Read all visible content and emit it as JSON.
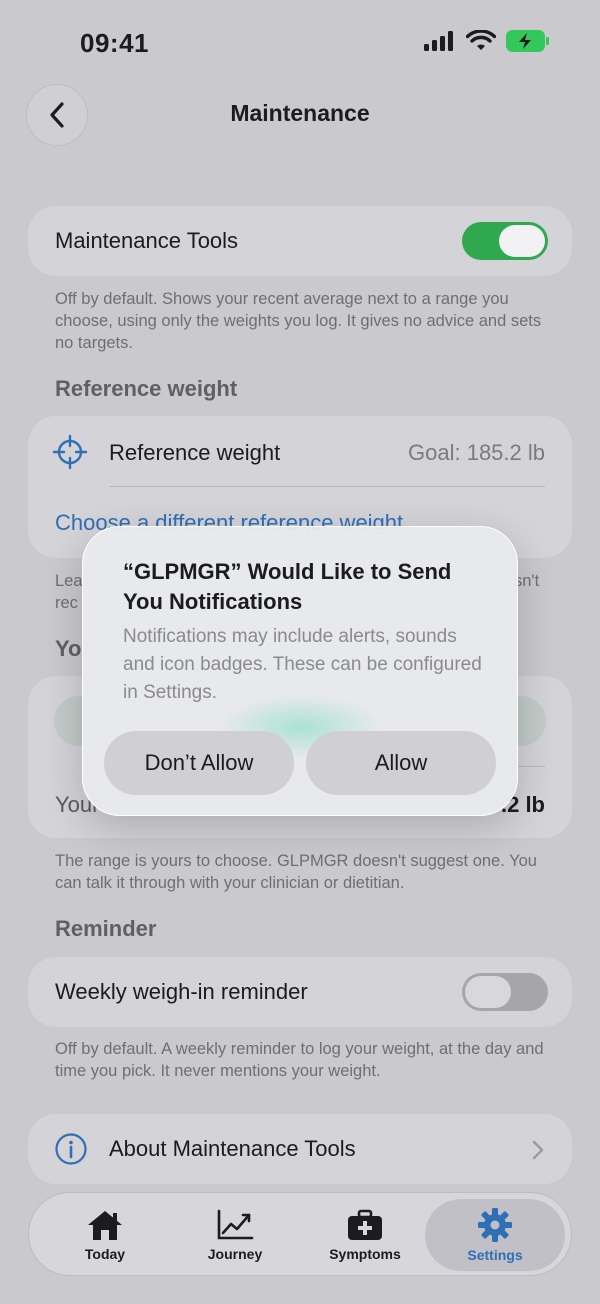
{
  "status_bar": {
    "time": "09:41"
  },
  "nav": {
    "title": "Maintenance"
  },
  "maintenance_tools": {
    "label": "Maintenance Tools",
    "enabled": true,
    "footnote": "Off by default. Shows your recent average next to a range you choose, using only the weights you log. It gives no advice and sets no targets."
  },
  "reference_weight": {
    "section_header": "Reference weight",
    "row_label": "Reference weight",
    "row_value": "Goal: 185.2 lb",
    "link": "Choose a different reference weight",
    "footnote_left": "Lea",
    "footnote_left2": "rec",
    "footnote_right": "sn't"
  },
  "range": {
    "section_header_fragment": "Yo",
    "row_label_fragment": "Your",
    "row_value_fragment": ".2 lb",
    "footnote": "The range is yours to choose. GLPMGR doesn't suggest one. You can talk it through with your clinician or dietitian."
  },
  "reminder": {
    "section_header": "Reminder",
    "label": "Weekly weigh-in reminder",
    "enabled": false,
    "footnote": "Off by default. A weekly reminder to log your weight, at the day and time you pick. It never mentions your weight."
  },
  "about": {
    "label": "About Maintenance Tools"
  },
  "dialog": {
    "title": "“GLPMGR” Would Like to Send You Notifications",
    "message": "Notifications may include alerts, sounds and icon badges. These can be configured in Settings.",
    "deny_label": "Don’t Allow",
    "allow_label": "Allow"
  },
  "tabbar": {
    "tabs": [
      {
        "label": "Today",
        "icon": "house-icon"
      },
      {
        "label": "Journey",
        "icon": "chart-line-icon"
      },
      {
        "label": "Symptoms",
        "icon": "medical-kit-icon"
      },
      {
        "label": "Settings",
        "icon": "gear-icon",
        "active": true
      }
    ]
  },
  "colors": {
    "accent": "#2f6fb6",
    "toggle_on": "#2fa84f"
  }
}
